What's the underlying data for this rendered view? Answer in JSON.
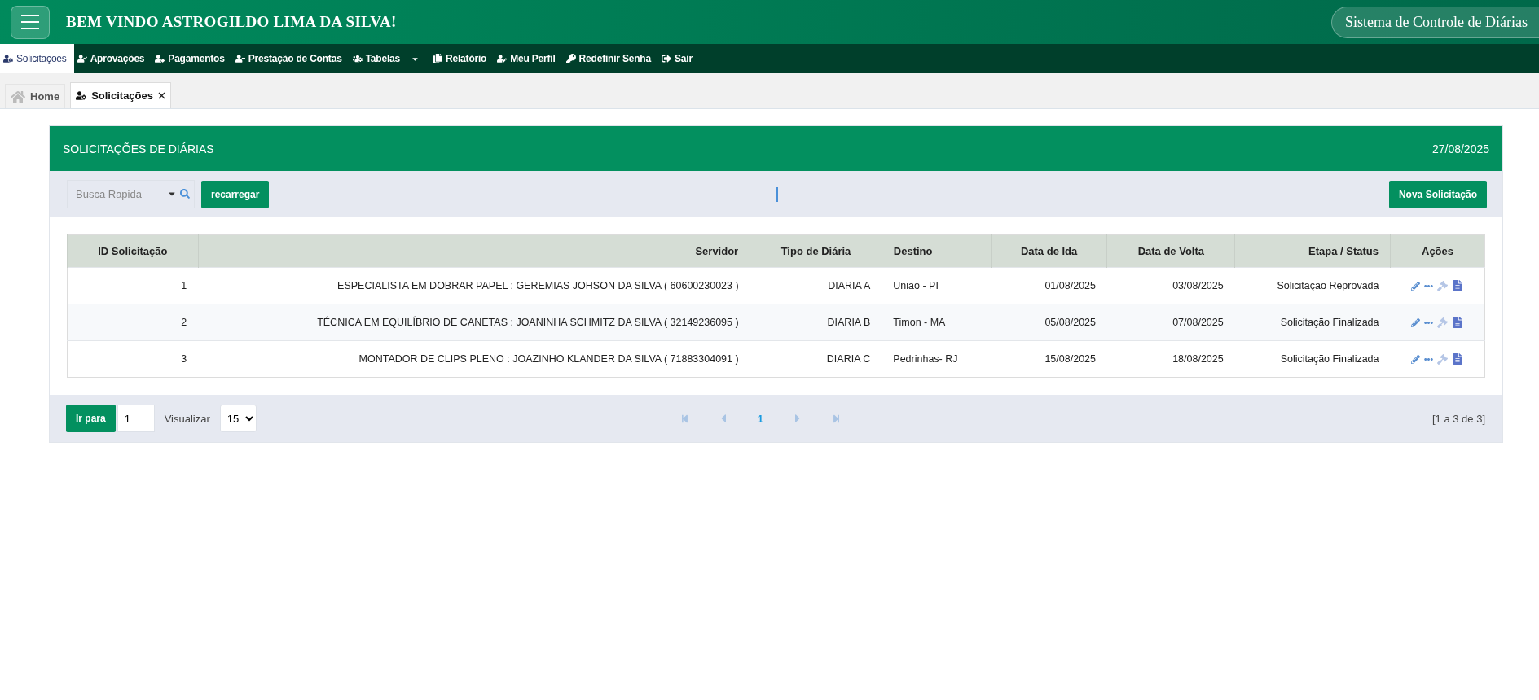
{
  "header": {
    "title": "BEM VINDO ASTROGILDO LIMA DA SILVA!",
    "system_name": "Sistema de Controle de Diárias"
  },
  "menu": [
    {
      "label": "Solicitações",
      "selected": true
    },
    {
      "label": "Aprovações",
      "selected": false
    },
    {
      "label": "Pagamentos",
      "selected": false
    },
    {
      "label": "Prestação de Contas",
      "selected": false
    },
    {
      "label": "Tabelas",
      "selected": false,
      "dropdown": true
    },
    {
      "label": "Relatório",
      "selected": false
    },
    {
      "label": "Meu Perfil",
      "selected": false
    },
    {
      "label": "Redefinir Senha",
      "selected": false
    },
    {
      "label": "Sair",
      "selected": false
    }
  ],
  "tabs": [
    {
      "label": "Home",
      "selected": false,
      "kind": "home"
    },
    {
      "label": "Solicitações",
      "selected": true,
      "kind": "page",
      "closable": true
    }
  ],
  "panel": {
    "title": "SOLICITAÇÕES DE DIÁRIAS",
    "date": "27/08/2025"
  },
  "toolbar": {
    "search_placeholder": "Busca Rapida",
    "reload_button": "recarregar",
    "new_button": "Nova Solicitação"
  },
  "table": {
    "columns": [
      "ID Solicitação",
      "Servidor",
      "Tipo de Diária",
      "Destino",
      "Data de Ida",
      "Data de Volta",
      "Etapa / Status",
      "Ações"
    ],
    "rows": [
      {
        "id": "1",
        "servidor": "ESPECIALISTA EM DOBRAR PAPEL : GEREMIAS JOHSON DA SILVA ( 60600230023 )",
        "tipo": "DIARIA A",
        "destino": "União - PI",
        "ida": "01/08/2025",
        "volta": "03/08/2025",
        "status": "Solicitação Reprovada"
      },
      {
        "id": "2",
        "servidor": "TÉCNICA EM EQUILÍBRIO DE CANETAS : JOANINHA SCHMITZ DA SILVA ( 32149236095 )",
        "tipo": "DIARIA B",
        "destino": "Timon - MA",
        "ida": "05/08/2025",
        "volta": "07/08/2025",
        "status": "Solicitação Finalizada"
      },
      {
        "id": "3",
        "servidor": "MONTADOR DE CLIPS PLENO : JOAZINHO KLANDER DA SILVA ( 71883304091 )",
        "tipo": "DIARIA C",
        "destino": "Pedrinhas- RJ",
        "ida": "15/08/2025",
        "volta": "18/08/2025",
        "status": "Solicitação Finalizada"
      }
    ]
  },
  "footer": {
    "goto_button": "Ir para",
    "goto_value": "1",
    "view_label": "Visualizar",
    "page_size": "15",
    "pages": [
      {
        "label": "1",
        "selected": true
      }
    ],
    "range": "[1 a 3 de 3]"
  }
}
